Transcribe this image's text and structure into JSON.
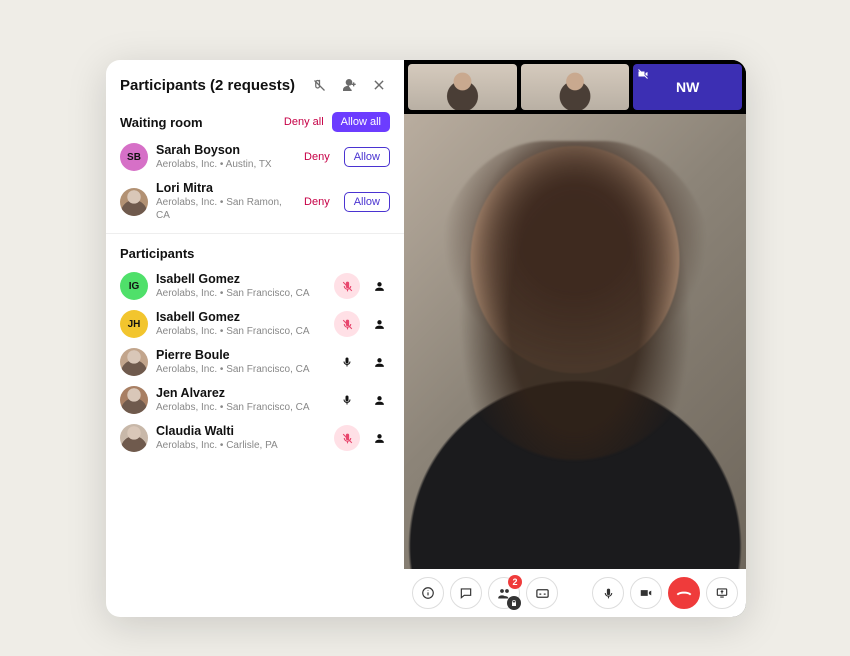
{
  "panel": {
    "title": "Participants (2 requests)",
    "icons": {
      "muteAll": "mute-all",
      "addPerson": "add-person",
      "close": "close"
    }
  },
  "waitingRoom": {
    "heading": "Waiting room",
    "denyAll": "Deny all",
    "allowAll": "Allow all",
    "denyLabel": "Deny",
    "allowLabel": "Allow",
    "entries": [
      {
        "initials": "SB",
        "avatarColor": "#d670c7",
        "name": "Sarah Boyson",
        "meta": "Aerolabs, Inc.  •  Austin, TX"
      },
      {
        "initials": "",
        "avatarColor": "#b29173",
        "photo": true,
        "name": "Lori Mitra",
        "meta": "Aerolabs, Inc.  •  San Ramon, CA"
      }
    ]
  },
  "participants": {
    "heading": "Participants",
    "entries": [
      {
        "initials": "IG",
        "avatarColor": "#4fe06a",
        "name": "Isabell Gomez",
        "meta": "Aerolabs, Inc.  •  San Francisco, CA",
        "muted": true
      },
      {
        "initials": "JH",
        "avatarColor": "#f2c52e",
        "name": "Isabell Gomez",
        "meta": "Aerolabs, Inc.  •  San Francisco, CA",
        "muted": true
      },
      {
        "initials": "",
        "avatarColor": "#c2a58c",
        "photo": true,
        "name": "Pierre Boule",
        "meta": "Aerolabs, Inc.  •  San Francisco, CA",
        "muted": false
      },
      {
        "initials": "",
        "avatarColor": "#a87f63",
        "photo": true,
        "name": "Jen Alvarez",
        "meta": "Aerolabs, Inc.  •  San Francisco, CA",
        "muted": false
      },
      {
        "initials": "",
        "avatarColor": "#c8b8a9",
        "photo": true,
        "name": "Claudia Walti",
        "meta": "Aerolabs, Inc.  •  Carlisle, PA",
        "muted": true
      }
    ]
  },
  "filmstrip": {
    "thumbs": [
      {
        "kind": "person"
      },
      {
        "kind": "person"
      },
      {
        "kind": "card",
        "label": "NW"
      }
    ]
  },
  "controls": {
    "badgeCount": "2"
  }
}
